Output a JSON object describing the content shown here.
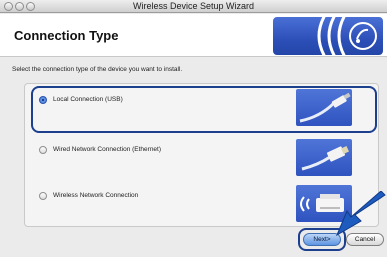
{
  "window": {
    "title": "Wireless Device Setup Wizard"
  },
  "header": {
    "title": "Connection Type"
  },
  "instruction": "Select the connection type of the device you want to install.",
  "options": [
    {
      "label": "Local Connection (USB)",
      "selected": true
    },
    {
      "label": "Wired Network Connection (Ethernet)",
      "selected": false
    },
    {
      "label": "Wireless Network Connection",
      "selected": false
    }
  ],
  "buttons": {
    "next": "Next>",
    "cancel": "Cancel"
  },
  "colors": {
    "brand_blue": "#2c4fb8",
    "highlight": "#1c3f8e",
    "arrow": "#1e5bbf"
  }
}
